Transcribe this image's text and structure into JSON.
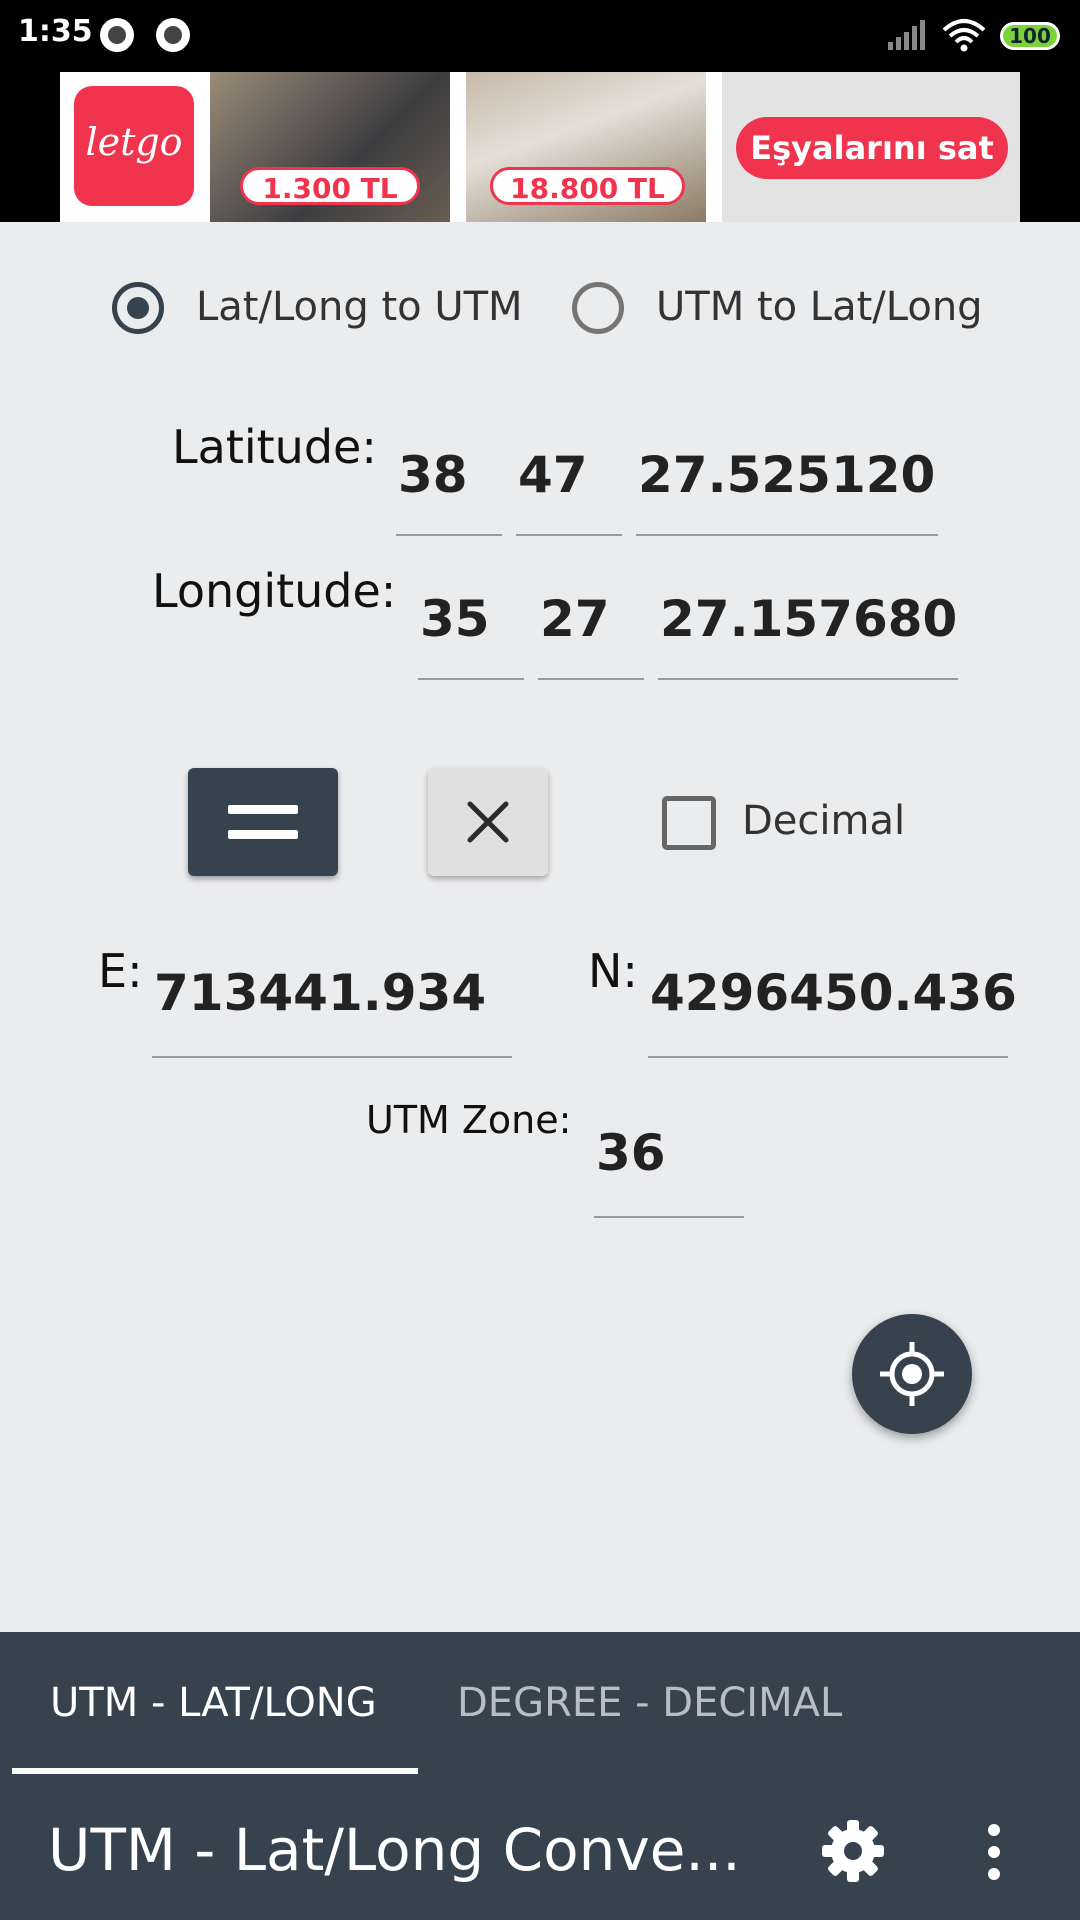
{
  "status_bar": {
    "time": "1:35",
    "battery": "100"
  },
  "ad": {
    "logo": "letgo",
    "price_1": "1.300 TL",
    "price_2": "18.800 TL",
    "cta": "Eşyalarını sat"
  },
  "mode": {
    "options": [
      "Lat/Long to UTM",
      "UTM to Lat/Long"
    ],
    "selected": "Lat/Long to UTM"
  },
  "latitude": {
    "label": "Latitude:",
    "deg": "38",
    "min": "47",
    "sec": "27.525120"
  },
  "longitude": {
    "label": "Longitude:",
    "deg": "35",
    "min": "27",
    "sec": "27.157680"
  },
  "decimal": {
    "label": "Decimal",
    "checked": false
  },
  "utm": {
    "e_label": "E:",
    "e_value": "713441.934",
    "n_label": "N:",
    "n_value": "4296450.436",
    "zone_label": "UTM Zone:",
    "zone_value": "36"
  },
  "tabs": [
    "UTM - LAT/LONG",
    "DEGREE - DECIMAL"
  ],
  "active_tab": "UTM - LAT/LONG",
  "app_bar": {
    "title": "UTM - Lat/Long Conve..."
  },
  "icons": {
    "equals": "equals-icon",
    "clear": "close-icon",
    "locate": "gps-target-icon",
    "settings": "gear-icon",
    "more": "more-vertical-icon"
  },
  "colors": {
    "primary": "#37424f",
    "ad_accent": "#f0344d",
    "background": "#ebecee"
  }
}
